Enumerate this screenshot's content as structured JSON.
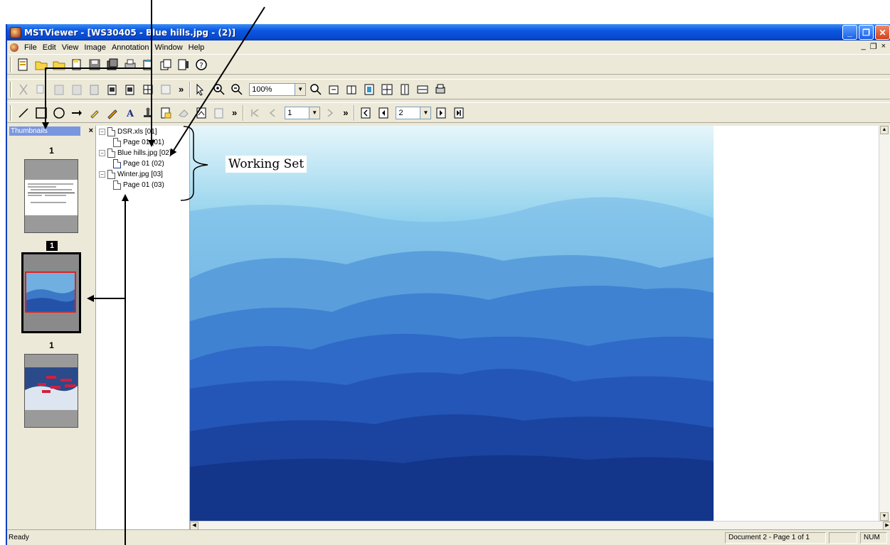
{
  "window": {
    "title": "MSTViewer - [WS30405 - Blue hills.jpg - (2)]",
    "controls": {
      "minimize": "_",
      "restore": "❐",
      "close": "✕"
    }
  },
  "menubar": {
    "items": [
      "File",
      "Edit",
      "View",
      "Image",
      "Annotation",
      "Window",
      "Help"
    ],
    "mdi_controls": {
      "minimize": "_",
      "restore": "❐",
      "close": "×"
    }
  },
  "toolbars": {
    "zoom": "100%",
    "page_nav": "1",
    "doc_nav": "2",
    "overflow": "»"
  },
  "thumbnails": {
    "header": "Thumbnails",
    "close": "×",
    "pages": [
      {
        "number": "1",
        "selected": false
      },
      {
        "number": "1",
        "selected": true
      },
      {
        "number": "1",
        "selected": false
      }
    ]
  },
  "tree": {
    "documents": [
      {
        "name": "DSR.xls [01]",
        "expander": "−",
        "page": "Page 01 (01)"
      },
      {
        "name": "Blue hills.jpg [02]",
        "expander": "−",
        "page": "Page 01 (02)"
      },
      {
        "name": "Winter.jpg [03]",
        "expander": "−",
        "page": "Page 01 (03)"
      }
    ]
  },
  "annotation": {
    "label": "Working Set"
  },
  "status": {
    "ready": "Ready",
    "document": "Document 2 - Page 1 of 1",
    "num": "NUM"
  },
  "colors": {
    "titlebar": "#0a56e0",
    "chrome": "#ece9d8",
    "selection": "#7a96df"
  }
}
